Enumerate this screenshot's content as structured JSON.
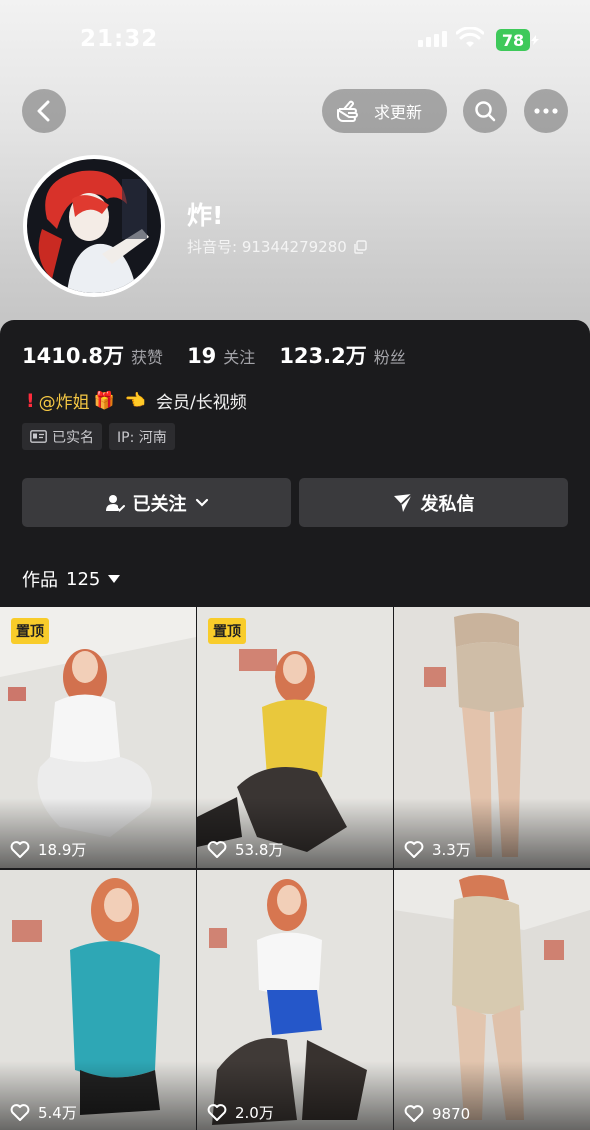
{
  "status_bar": {
    "time": "21:32",
    "battery": "78"
  },
  "header": {
    "update_label": "求更新"
  },
  "profile": {
    "nickname": "炸!",
    "douyin_id": "抖音号: 91344279280"
  },
  "stats": [
    {
      "value": "1410.8万",
      "label": "获赞"
    },
    {
      "value": "19",
      "label": "关注"
    },
    {
      "value": "123.2万",
      "label": "粉丝"
    }
  ],
  "bio": {
    "exclamation": "!",
    "mention": "@炸姐",
    "gift": "🎁",
    "pointer": "👈",
    "text": "会员/长视频"
  },
  "tags": [
    {
      "icon": "id-card-icon",
      "label": "已实名"
    },
    {
      "label": "IP: 河南"
    }
  ],
  "actions": {
    "follow_label": "已关注",
    "message_label": "发私信"
  },
  "works_tab": {
    "label": "作品",
    "count": "125"
  },
  "videos": [
    {
      "likes": "18.9万",
      "pinned": "置顶"
    },
    {
      "likes": "53.8万",
      "pinned": "置顶"
    },
    {
      "likes": "3.3万"
    },
    {
      "likes": "5.4万"
    },
    {
      "likes": "2.0万"
    },
    {
      "likes": "9870"
    }
  ],
  "colors": {
    "accent_pin": "#f8cc2a",
    "battery": "#3ec95a",
    "panel": "#1b1b1d"
  }
}
